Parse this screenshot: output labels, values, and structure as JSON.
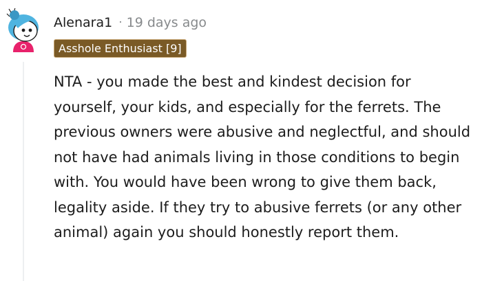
{
  "comment": {
    "author": "Alenara1",
    "separator": "·",
    "timestamp": "19 days ago",
    "flair": {
      "text": "Asshole Enthusiast [9]",
      "background_color": "#7a5a26"
    },
    "body": "NTA - you made the best and kindest decision for yourself, your kids, and especially for the ferrets. The previous owners were abusive and neglectful, and should not have had animals living in those conditions to begin with. You would have been wrong to give them back, legality aside. If they try to abusive ferrets (or any other animal) again you should honestly report them.",
    "avatar_icon": "snoo-avatar-icon"
  },
  "colors": {
    "text": "#1c1c1c",
    "meta_text": "#878a8c",
    "thread_line": "#edeff1",
    "avatar_hair": "#4fb4e0",
    "avatar_shirt": "#e8226b"
  }
}
